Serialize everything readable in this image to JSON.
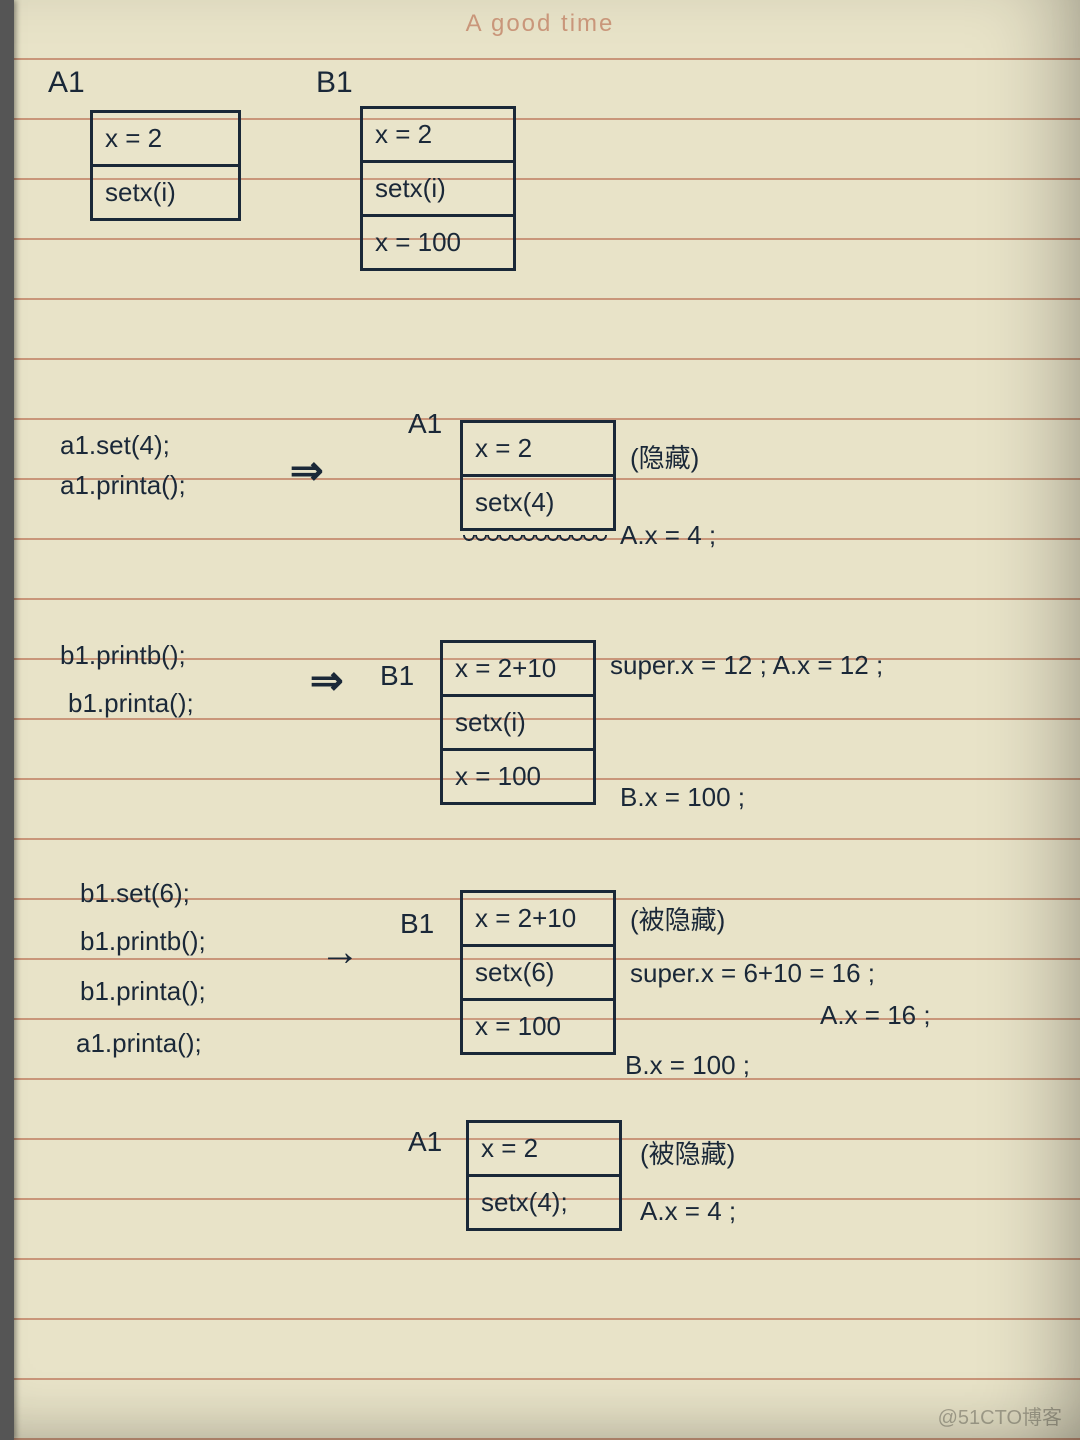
{
  "header": {
    "title": "A good time"
  },
  "top": {
    "a1_label": "A1",
    "b1_label": "B1",
    "a1_box": [
      "x = 2",
      "setx(i)"
    ],
    "b1_box": [
      "x = 2",
      "setx(i)",
      "x = 100"
    ]
  },
  "step1": {
    "code": [
      "a1.set(4);",
      "a1.printa();"
    ],
    "arrow": "⇒",
    "box_label": "A1",
    "box": [
      "x = 2",
      "setx(4)"
    ],
    "side_note_top": "(隐藏)",
    "side_note_bottom": "A.x = 4 ;"
  },
  "step2": {
    "code": [
      "b1.printb();",
      "b1.printa();"
    ],
    "arrow": "⇒",
    "box_label": "B1",
    "box": [
      "x = 2+10",
      "setx(i)",
      "x = 100"
    ],
    "side_note_top": "super.x = 12 ;  A.x = 12 ;",
    "side_note_bottom": "B.x = 100 ;"
  },
  "step3": {
    "code": [
      "b1.set(6);",
      "b1.printb();",
      "b1.printa();",
      "a1.printa();"
    ],
    "arrow": "→",
    "box_label_b": "B1",
    "box_b": [
      "x = 2+10",
      "setx(6)",
      "x = 100"
    ],
    "b_note_top": "(被隐藏)",
    "b_note_mid": "super.x = 6+10 = 16 ;",
    "b_note_mid2": "A.x = 16 ;",
    "b_note_bottom": "B.x = 100 ;",
    "box_label_a": "A1",
    "box_a": [
      "x = 2",
      "setx(4);"
    ],
    "a_note_top": "(被隐藏)",
    "a_note_bottom": "A.x = 4 ;"
  },
  "watermark": "@51CTO博客"
}
